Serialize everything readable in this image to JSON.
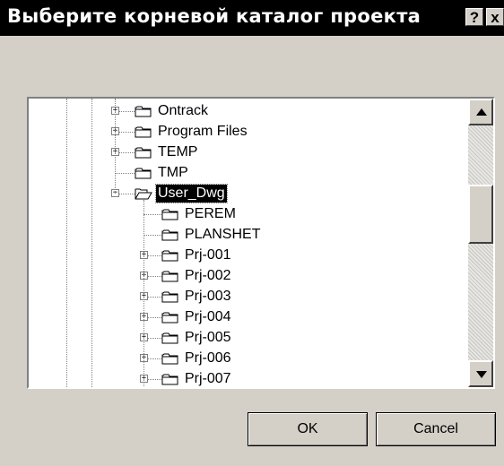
{
  "window": {
    "title": "Выберите корневой каталог проекта",
    "help_label": "?",
    "close_label": "x"
  },
  "tree": {
    "items": [
      {
        "label": "Ontrack",
        "level": 1,
        "expander": "+",
        "selected": false
      },
      {
        "label": "Program Files",
        "level": 1,
        "expander": "+",
        "selected": false
      },
      {
        "label": "TEMP",
        "level": 1,
        "expander": "+",
        "selected": false
      },
      {
        "label": "TMP",
        "level": 1,
        "expander": "",
        "selected": false
      },
      {
        "label": "User_Dwg",
        "level": 1,
        "expander": "-",
        "selected": true,
        "open": true
      },
      {
        "label": "PEREM",
        "level": 2,
        "expander": "",
        "selected": false
      },
      {
        "label": "PLANSHET",
        "level": 2,
        "expander": "",
        "selected": false
      },
      {
        "label": "Prj-001",
        "level": 2,
        "expander": "+",
        "selected": false
      },
      {
        "label": "Prj-002",
        "level": 2,
        "expander": "+",
        "selected": false
      },
      {
        "label": "Prj-003",
        "level": 2,
        "expander": "+",
        "selected": false
      },
      {
        "label": "Prj-004",
        "level": 2,
        "expander": "+",
        "selected": false
      },
      {
        "label": "Prj-005",
        "level": 2,
        "expander": "+",
        "selected": false
      },
      {
        "label": "Prj-006",
        "level": 2,
        "expander": "+",
        "selected": false
      },
      {
        "label": "Prj-007",
        "level": 2,
        "expander": "+",
        "selected": false
      }
    ]
  },
  "buttons": {
    "ok_label": "OK",
    "cancel_label": "Cancel"
  },
  "colors": {
    "face": "#d4d0c8",
    "titlebar": "#000000",
    "selection": "#000000"
  }
}
